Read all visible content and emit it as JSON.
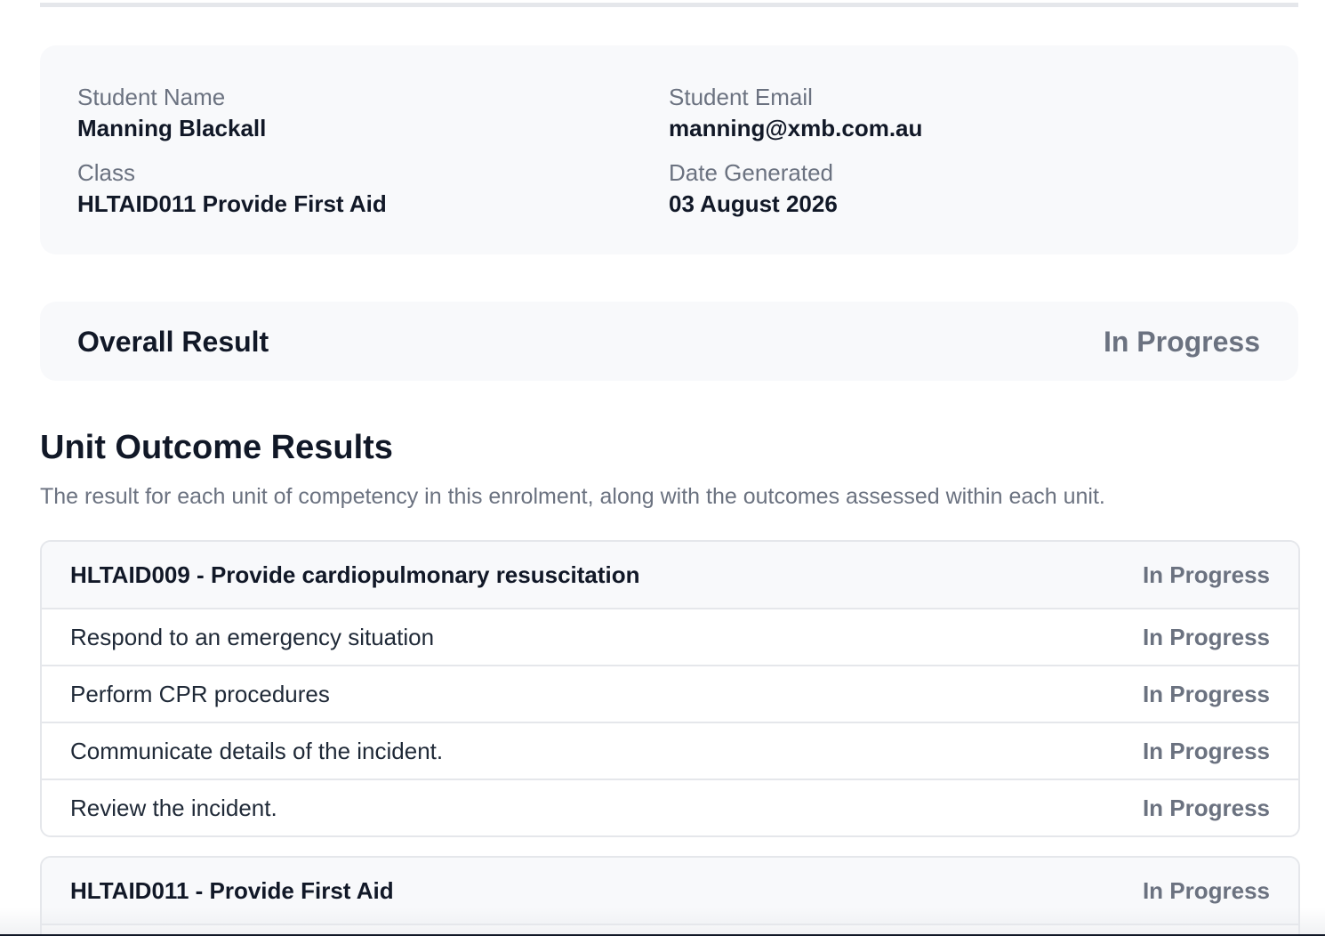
{
  "student_info": {
    "name_label": "Student Name",
    "name_value": "Manning Blackall",
    "email_label": "Student Email",
    "email_value": "manning@xmb.com.au",
    "class_label": "Class",
    "class_value": "HLTAID011 Provide First Aid",
    "date_label": "Date Generated",
    "date_value": "03 August 2026"
  },
  "overall": {
    "label": "Overall Result",
    "status": "In Progress"
  },
  "unit_outcomes": {
    "title": "Unit Outcome Results",
    "description": "The result for each unit of competency in this enrolment, along with the outcomes assessed within each unit.",
    "units": [
      {
        "title": "HLTAID009 - Provide cardiopulmonary resuscitation",
        "status": "In Progress",
        "outcomes": [
          {
            "label": "Respond to an emergency situation",
            "status": "In Progress"
          },
          {
            "label": "Perform CPR procedures",
            "status": "In Progress"
          },
          {
            "label": "Communicate details of the incident.",
            "status": "In Progress"
          },
          {
            "label": "Review the incident.",
            "status": "In Progress"
          }
        ]
      },
      {
        "title": "HLTAID011 - Provide First Aid",
        "status": "In Progress",
        "outcomes": []
      }
    ]
  },
  "colors": {
    "card_background": "#f8f9fb",
    "border": "#e5e7eb",
    "muted_text": "#6b7280",
    "primary_text": "#111827"
  }
}
